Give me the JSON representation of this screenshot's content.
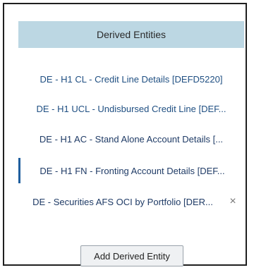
{
  "panel": {
    "title": "Derived Entities",
    "items": [
      {
        "label": "DE - H1 CL - Credit Line Details [DEFD5220]"
      },
      {
        "label": "DE - H1 UCL - Undisbursed Credit Line [DEF..."
      },
      {
        "label": "DE - H1 AC - Stand Alone Account Details [..."
      },
      {
        "label": "DE - H1 FN - Fronting Account Details [DEF..."
      },
      {
        "label": "DE - Securities AFS OCI by Portfolio [DER..."
      }
    ],
    "close_symbol": "×",
    "add_button_label": "Add Derived Entity"
  }
}
